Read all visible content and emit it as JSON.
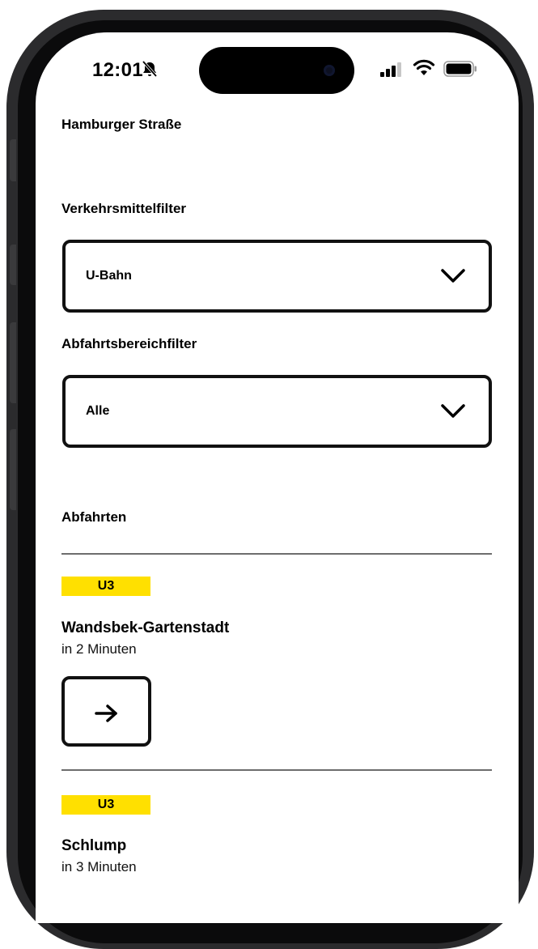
{
  "status_bar": {
    "time": "12:01",
    "icons": [
      "bell-slash-icon",
      "signal-icon",
      "wifi-icon",
      "battery-icon"
    ]
  },
  "station": {
    "name": "Hamburger Straße"
  },
  "filters": {
    "transport": {
      "label": "Verkehrsmittelfilter",
      "selected": "U-Bahn"
    },
    "area": {
      "label": "Abfahrtsbereichfilter",
      "selected": "Alle"
    }
  },
  "departures": {
    "heading": "Abfahrten",
    "items": [
      {
        "line": "U3",
        "destination": "Wandsbek-Gartenstadt",
        "eta": "in 2 Minuten",
        "action_icon": "arrow-right-icon"
      },
      {
        "line": "U3",
        "destination": "Schlump",
        "eta": "in 3 Minuten"
      }
    ]
  },
  "colors": {
    "line_badge": "#ffe000",
    "border": "#111111",
    "divider": "#6d6d6d",
    "text": "#000000"
  }
}
